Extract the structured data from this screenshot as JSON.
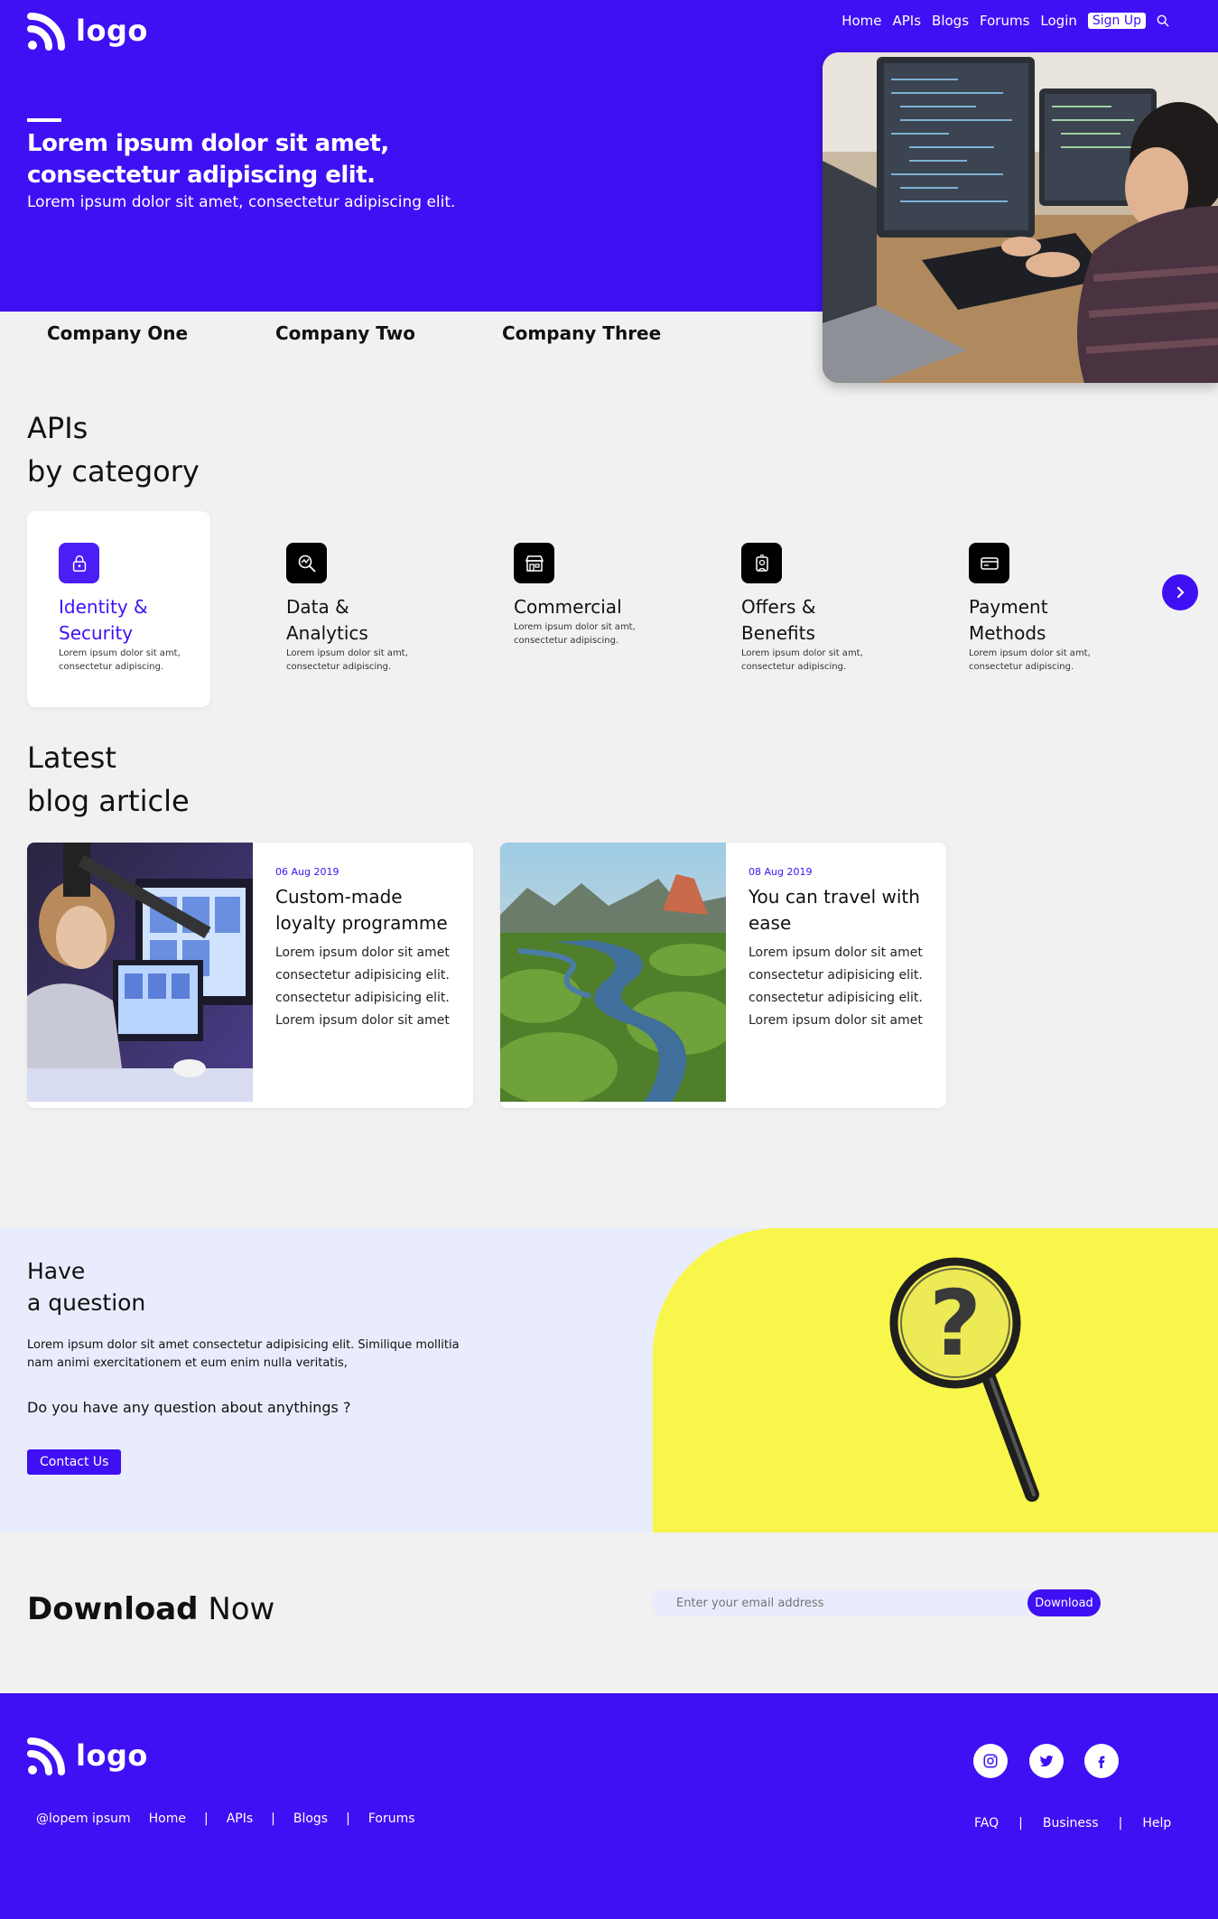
{
  "brand": {
    "logo_text": "logo"
  },
  "nav": {
    "items": [
      "Home",
      "APIs",
      "Blogs",
      "Forums",
      "Login"
    ],
    "signup_label": "Sign Up"
  },
  "hero": {
    "title": "Lorem ipsum dolor sit amet, consectetur adipiscing elit.",
    "subtitle": "Lorem ipsum dolor sit amet, consectetur adipiscing elit."
  },
  "companies": [
    "Company One",
    "Company Two",
    "Company Three"
  ],
  "apis": {
    "title_line1": "APIs",
    "title_line2": "by category",
    "categories": [
      {
        "name": "Identity & Security",
        "desc": "Lorem ipsum dolor sit amt, consectetur adipiscing.",
        "icon": "lock-icon"
      },
      {
        "name": "Data & Analytics",
        "desc": "Lorem ipsum dolor sit amt, consectetur adipiscing.",
        "icon": "analytics-search-icon"
      },
      {
        "name": "Commercial",
        "desc": "Lorem ipsum dolor sit amt, consectetur adipiscing.",
        "icon": "store-icon"
      },
      {
        "name": "Offers & Benefits",
        "desc": "Lorem ipsum dolor sit amt, consectetur adipiscing.",
        "icon": "gift-offer-icon"
      },
      {
        "name": "Payment Methods",
        "desc": "Lorem ipsum dolor sit amt, consectetur adipiscing.",
        "icon": "credit-card-icon"
      }
    ]
  },
  "blog": {
    "title_line1": "Latest",
    "title_line2": "blog article",
    "articles": [
      {
        "date": "06 Aug 2019",
        "title": "Custom-made loyalty programme",
        "body": "Lorem ipsum dolor sit amet consectetur adipisicing elit. consectetur adipisicing elit. Lorem ipsum dolor sit amet"
      },
      {
        "date": "08 Aug 2019",
        "title": "You can travel with ease",
        "body": "Lorem ipsum dolor sit amet consectetur adipisicing elit. consectetur adipisicing elit. Lorem ipsum dolor sit amet"
      }
    ]
  },
  "question": {
    "title_line1": "Have",
    "title_line2": "a question",
    "text": "Lorem ipsum dolor sit amet consectetur adipisicing elit. Similique mollitia nam animi exercitationem et eum enim nulla veritatis,",
    "ask": "Do you have any question about anythings ?",
    "button": "Contact Us"
  },
  "download": {
    "title_bold": "Download",
    "title_rest": "Now",
    "placeholder": "Enter your email address",
    "button": "Download"
  },
  "footer": {
    "logo_text": "logo",
    "handle": "@lopem ipsum",
    "links": [
      "Home",
      "APIs",
      "Blogs",
      "Forums"
    ],
    "right_links": [
      "FAQ",
      "Business",
      "Help"
    ],
    "separator": "|",
    "social": [
      "instagram-icon",
      "twitter-icon",
      "facebook-icon"
    ]
  },
  "colors": {
    "brand": "#3f10f4",
    "light_bg": "#e9ecfc",
    "yellow": "#f8f64a",
    "page_bg": "#f1f1f1"
  }
}
